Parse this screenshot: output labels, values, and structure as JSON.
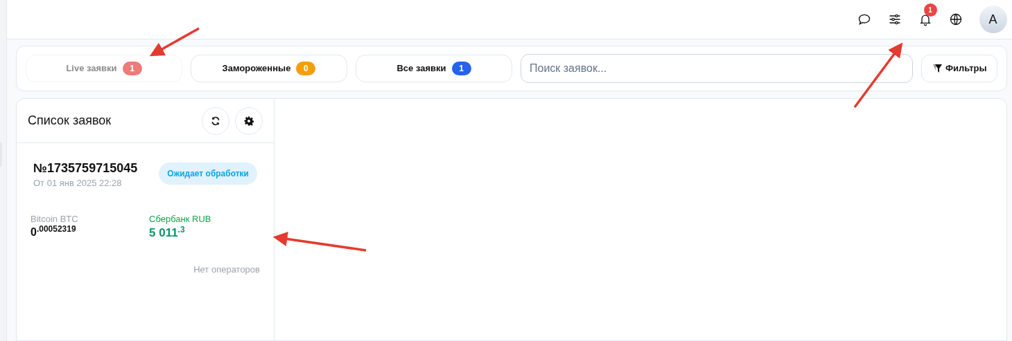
{
  "header": {
    "notifications_badge": "1",
    "avatar_letter": "A"
  },
  "tabs": [
    {
      "label": "Live заявки",
      "count": "1",
      "color": "#ee7a7a",
      "selected": true
    },
    {
      "label": "Замороженные",
      "count": "0",
      "color": "#f59e0b",
      "selected": false
    },
    {
      "label": "Все заявки",
      "count": "1",
      "color": "#2563eb",
      "selected": false
    }
  ],
  "search": {
    "placeholder": "Поиск заявок..."
  },
  "filter_button": "Фильтры",
  "list": {
    "title": "Список заявок",
    "orders": [
      {
        "number": "№1735759715045",
        "date": "От 01 янв 2025 22:28",
        "status": "Ожидает обработки",
        "from_label": "Bitcoin BTC",
        "from_amount": "0$^{.00052319}$",
        "to_label": "Сбербанк RUB",
        "to_amount": "5 011$^{.3}$",
        "operators": "Нет операторов"
      }
    ]
  }
}
